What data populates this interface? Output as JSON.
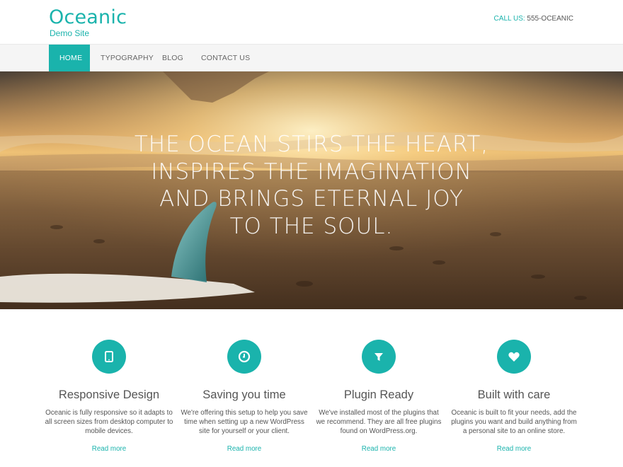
{
  "site": {
    "title": "Oceanic",
    "tagline": "Demo Site"
  },
  "contact": {
    "label": "CALL US:",
    "value": "555-OCEANIC"
  },
  "nav": {
    "items": [
      {
        "label": "HOME",
        "active": true
      },
      {
        "label": "TYPOGRAPHY",
        "active": false
      },
      {
        "label": "BLOG",
        "active": false
      },
      {
        "label": "CONTACT US",
        "active": false
      }
    ]
  },
  "hero": {
    "lines": [
      "THE OCEAN STIRS THE HEART,",
      "INSPIRES THE IMAGINATION",
      "AND BRINGS ETERNAL JOY",
      "TO THE SOUL."
    ]
  },
  "features": [
    {
      "icon": "tablet-icon",
      "title": "Responsive Design",
      "description": "Oceanic is fully responsive so it adapts to all screen sizes from desktop computer to mobile devices.",
      "link": "Read more"
    },
    {
      "icon": "clock-icon",
      "title": "Saving you time",
      "description": "We're offering this setup to help you save time when setting up a new WordPress site for yourself or your client.",
      "link": "Read more"
    },
    {
      "icon": "filter-icon",
      "title": "Plugin Ready",
      "description": "We've installed most of the plugins that we recommend. They are all free plugins found on WordPress.org.",
      "link": "Read more"
    },
    {
      "icon": "heart-icon",
      "title": "Built with care",
      "description": "Oceanic is built to fit your needs, add the plugins you want and build anything from a personal site to an online store.",
      "link": "Read more"
    }
  ],
  "colors": {
    "accent": "#1ab3ac",
    "text": "#555555",
    "nav_bg": "#f5f5f5"
  }
}
